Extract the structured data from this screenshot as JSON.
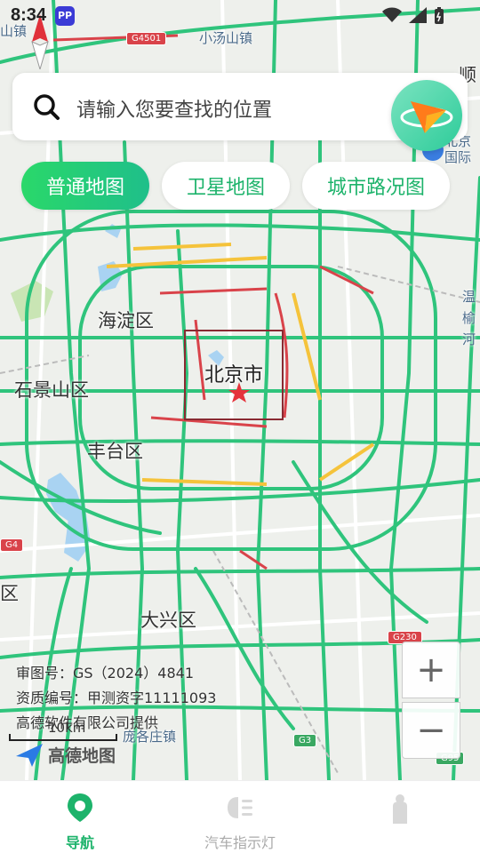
{
  "status_bar": {
    "time": "8:34",
    "app_badge": "PP"
  },
  "search": {
    "placeholder": "请输入您要查找的位置"
  },
  "map_tabs": [
    {
      "label": "普通地图",
      "active": true
    },
    {
      "label": "卫星地图",
      "active": false
    },
    {
      "label": "城市路况图",
      "active": false
    }
  ],
  "map_labels": {
    "xiaotangshan": "小汤山镇",
    "shunyi": "顺",
    "beijing_airport": "北京\n国际",
    "haidian": "海淀区",
    "beijing": "北京市",
    "shijingshan": "石景山区",
    "fengtai": "丰台区",
    "daxing": "大兴区",
    "panggezhuang": "庞各庄镇",
    "wenyu": "温\n榆\n河",
    "qu": "区",
    "shanzhen": "山镇"
  },
  "road_badges": {
    "g4501": "G4501",
    "g4": "G4",
    "g230": "G230",
    "g3": "G3",
    "g95": "G95"
  },
  "zoom": {
    "in": "+",
    "out": "−"
  },
  "attribution": {
    "review_no": "审图号：GS（2024）4841",
    "qualification_no": "资质编号：甲测资字11111093",
    "provider": "高德软件有限公司提供"
  },
  "scale_label": "10km",
  "brand": "高德地图",
  "bottom_nav": [
    {
      "label": "导航",
      "icon": "location-pin-icon",
      "active": true
    },
    {
      "label": "汽车指示灯",
      "icon": "car-light-icon",
      "active": false
    },
    {
      "label": "",
      "icon": "profile-icon",
      "active": false
    }
  ],
  "colors": {
    "accent": "#1db36b",
    "road_green": "#2fc47c",
    "road_yellow": "#f5c33b",
    "road_red": "#d9434a"
  }
}
